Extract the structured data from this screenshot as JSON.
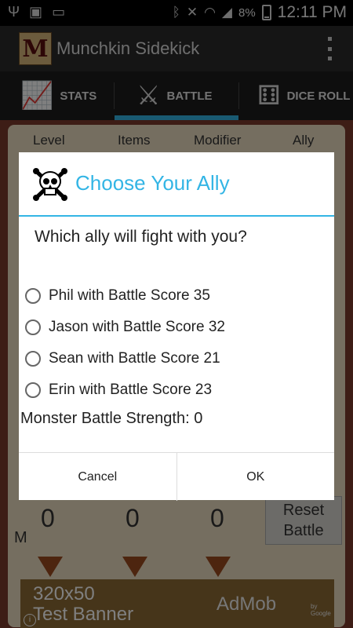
{
  "status_bar": {
    "battery_percent": "8%",
    "time": "12:11 PM",
    "left_icons": [
      "usb-icon",
      "image-icon",
      "message-icon"
    ],
    "right_icons": [
      "bluetooth-icon",
      "mute-icon",
      "wifi-icon",
      "signal-icon"
    ]
  },
  "app": {
    "title": "Munchkin Sidekick",
    "logo_letter": "M"
  },
  "tabs": [
    {
      "label": "STATS",
      "icon": "chart-icon",
      "selected": false
    },
    {
      "label": "BATTLE",
      "icon": "crossed-swords-icon",
      "selected": true
    },
    {
      "label": "DICE ROLL",
      "icon": "dice-icon",
      "selected": false
    }
  ],
  "background": {
    "columns": [
      "Level",
      "Items",
      "Modifier",
      "Ally"
    ],
    "values": [
      "0",
      "0",
      "0"
    ],
    "reset_button": "Reset\nBattle",
    "left_fragment": "M"
  },
  "ad": {
    "text": "320x50\nTest Banner",
    "brand": "AdMob",
    "by": "by Google",
    "info": "i"
  },
  "dialog": {
    "title": "Choose Your Ally",
    "question": "Which ally will fight with you?",
    "options": [
      "Phil with Battle Score 35",
      "Jason with Battle Score 32",
      "Sean with Battle Score 21",
      "Erin with Battle Score 23"
    ],
    "monster_strength": "Monster Battle Strength: 0",
    "cancel_label": "Cancel",
    "ok_label": "OK"
  },
  "colors": {
    "accent": "#33b5e5",
    "action_bar": "#2b2b2b",
    "tab_bar": "#1d1d1d",
    "parchment": "#eadcc0"
  }
}
